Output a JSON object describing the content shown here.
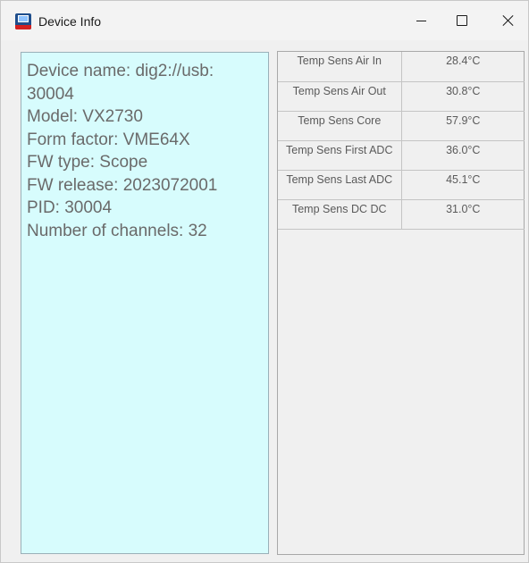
{
  "window": {
    "title": "Device Info",
    "controls": {
      "minimize_icon": "minimize-icon",
      "maximize_icon": "maximize-icon",
      "close_icon": "close-icon"
    }
  },
  "device_info": {
    "lines": [
      "Device name: dig2://usb:",
      "30004",
      "Model: VX2730",
      "Form factor: VME64X",
      "FW type: Scope",
      "FW release: 2023072001",
      "PID: 30004",
      "Number of channels: 32"
    ],
    "background_color": "#d7fcfd"
  },
  "temperatures": {
    "rows": [
      {
        "name": "Temp Sens Air In",
        "value": "28.4°C"
      },
      {
        "name": "Temp Sens Air Out",
        "value": "30.8°C"
      },
      {
        "name": "Temp Sens Core",
        "value": "57.9°C"
      },
      {
        "name": "Temp Sens First ADC",
        "value": "36.0°C"
      },
      {
        "name": "Temp Sens Last ADC",
        "value": "45.1°C"
      },
      {
        "name": "Temp Sens DC DC",
        "value": "31.0°C"
      }
    ]
  }
}
